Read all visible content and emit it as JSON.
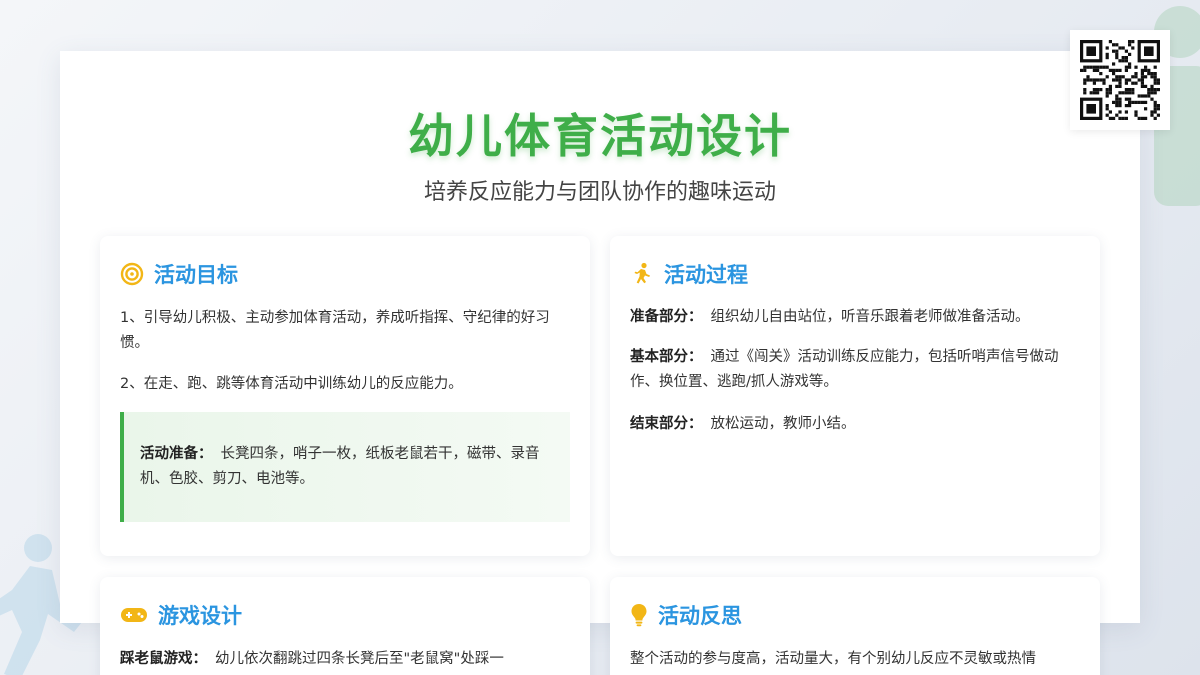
{
  "header": {
    "title": "幼儿体育活动设计",
    "subtitle": "培养反应能力与团队协作的趣味运动"
  },
  "goals": {
    "title": "活动目标",
    "icon": "target-icon",
    "items": [
      "1、引导幼儿积极、主动参加体育活动，养成听指挥、守纪律的好习惯。",
      "2、在走、跑、跳等体育活动中训练幼儿的反应能力。"
    ],
    "preparation": {
      "label": "活动准备：",
      "text": "长凳四条，哨子一枚，纸板老鼠若干，磁带、录音机、色胶、剪刀、电池等。"
    }
  },
  "process": {
    "title": "活动过程",
    "icon": "runner-icon",
    "steps": [
      {
        "label": "准备部分：",
        "text": "组织幼儿自由站位，听音乐跟着老师做准备活动。"
      },
      {
        "label": "基本部分：",
        "text": "通过《闯关》活动训练反应能力，包括听哨声信号做动作、换位置、逃跑/抓人游戏等。"
      },
      {
        "label": "结束部分：",
        "text": "放松运动，教师小结。"
      }
    ]
  },
  "game": {
    "title": "游戏设计",
    "icon": "gamepad-icon",
    "label": "踩老鼠游戏：",
    "text": "幼儿依次翻跳过四条长凳后至\"老鼠窝\"处踩一"
  },
  "reflection": {
    "title": "活动反思",
    "icon": "lightbulb-icon",
    "text": "整个活动的参与度高，活动量大，有个别幼儿反应不灵敏或热情"
  },
  "colors": {
    "title_green": "#3fae49",
    "heading_blue": "#2b95e0",
    "accent_yellow": "#f2b616",
    "box_bg": "#eef7ee"
  }
}
